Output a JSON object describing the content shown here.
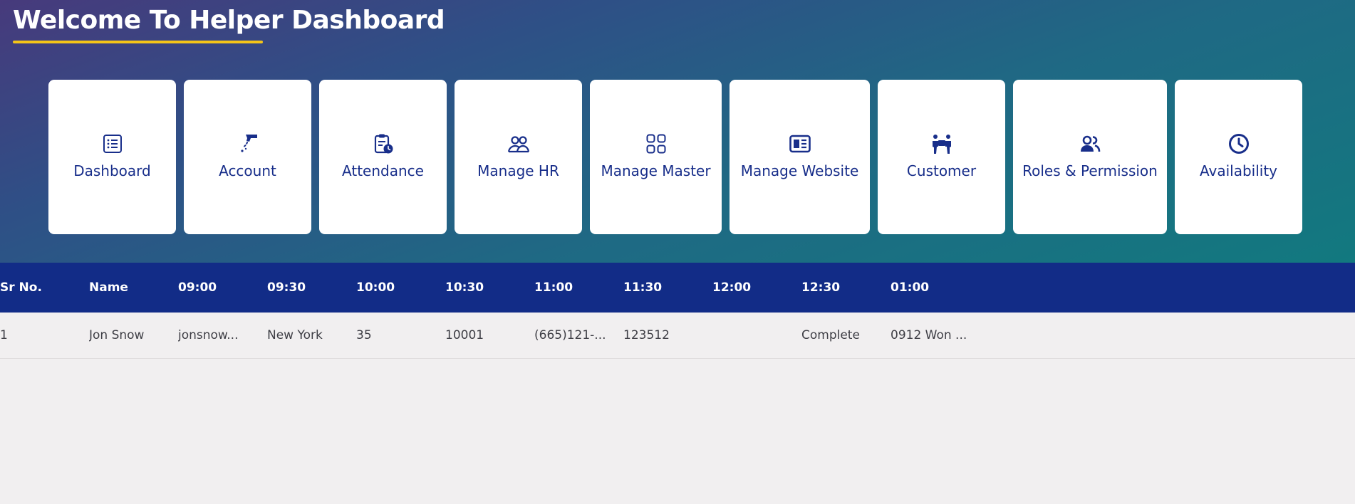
{
  "header": {
    "title": "Welcome To Helper Dashboard"
  },
  "nav_cards": [
    {
      "label": "Dashboard",
      "icon": "list-icon"
    },
    {
      "label": "Account",
      "icon": "hand-coin-icon"
    },
    {
      "label": "Attendance",
      "icon": "clipboard-clock-icon"
    },
    {
      "label": "Manage HR",
      "icon": "people-icon"
    },
    {
      "label": "Manage Master",
      "icon": "grid-icon"
    },
    {
      "label": "Manage Website",
      "icon": "newspaper-icon"
    },
    {
      "label": "Customer",
      "icon": "customers-icon"
    },
    {
      "label": "Roles & Permission",
      "icon": "user-group-icon"
    },
    {
      "label": "Availability",
      "icon": "clock-icon"
    }
  ],
  "table": {
    "columns": [
      "Sr No.",
      "Name",
      "09:00",
      "09:30",
      "10:00",
      "10:30",
      "11:00",
      "11:30",
      "12:00",
      "12:30",
      "01:00"
    ],
    "rows": [
      [
        "1",
        "Jon Snow",
        "jonsnow...",
        "New York",
        "35",
        "10001",
        "(665)121-...",
        "123512",
        "",
        "Complete",
        "0912 Won ..."
      ]
    ]
  },
  "colors": {
    "accent": "#f5c518",
    "primary": "#122c87",
    "card_text": "#182e8a",
    "background": "#f1eff0"
  }
}
